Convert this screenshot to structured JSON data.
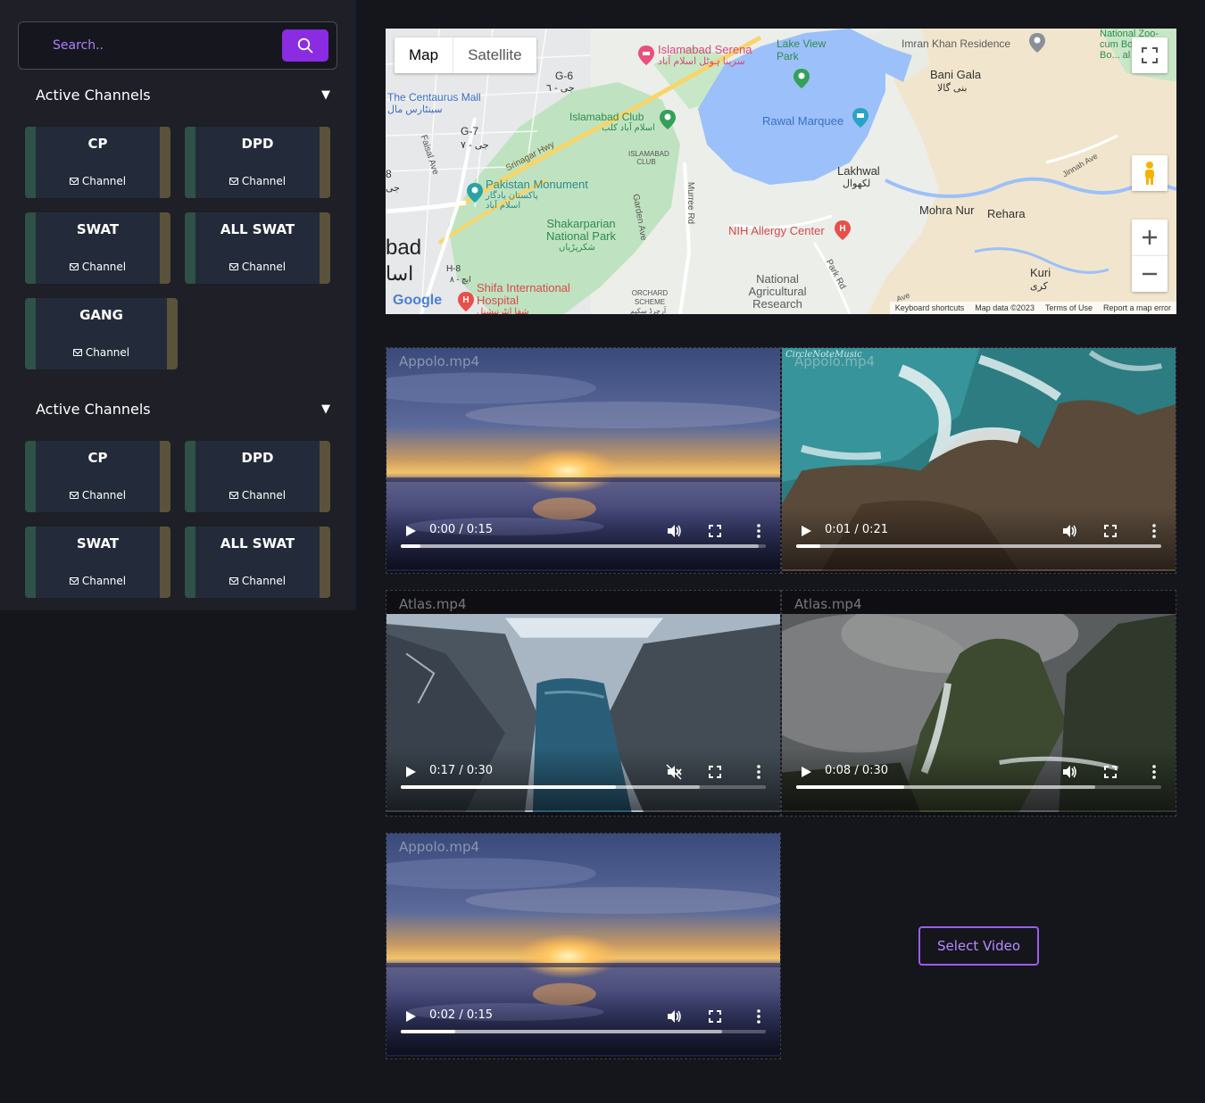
{
  "search": {
    "placeholder": "Search..",
    "button_icon": "search-icon"
  },
  "accent_color": "#8b2be2",
  "sections": [
    {
      "title": "Active Channels",
      "channels": [
        {
          "name": "CP",
          "sub": "Channel"
        },
        {
          "name": "DPD",
          "sub": "Channel"
        },
        {
          "name": "SWAT",
          "sub": "Channel"
        },
        {
          "name": "ALL SWAT",
          "sub": "Channel"
        },
        {
          "name": "GANG",
          "sub": "Channel"
        }
      ]
    },
    {
      "title": "Active Channels",
      "channels": [
        {
          "name": "CP",
          "sub": "Channel"
        },
        {
          "name": "DPD",
          "sub": "Channel"
        },
        {
          "name": "SWAT",
          "sub": "Channel"
        },
        {
          "name": "ALL SWAT",
          "sub": "Channel"
        }
      ]
    }
  ],
  "map": {
    "tabs": [
      "Map",
      "Satellite"
    ],
    "active_tab": "Map",
    "labels": {
      "serena": "Islamabad Serena",
      "serena_ur": "سرینا ہوٹل اسلام آباد",
      "lake_view": "Lake View Park",
      "imran": "Imran Khan Residence",
      "zoo": "National Zoo-cum Bo... & Bo... al Garden",
      "g6": "G-6",
      "g6_ur": "جی - ٦",
      "centaurus": "The Centaurus Mall",
      "centaurus_ur": "سینٹارس مال",
      "bani_gala": "Bani Gala",
      "bani_gala_ur": "بنی گالا",
      "club": "Islamabad Club",
      "club_ur": "اسلام آباد کلب",
      "rawal": "Rawal Marquee",
      "g7": "G-7",
      "g7_ur": "جی - ٧",
      "srinagar": "Srinagar Hwy",
      "isb_club_area": "ISLAMABAD CLUB",
      "lakhwal": "Lakhwal",
      "lakhwal_ur": "لکھوال",
      "faisal": "Faisal Ave",
      "monument": "Pakistan Monument",
      "monument_ur": "پاکستان یادگار اسلام آباد",
      "murree": "Murree Rd",
      "garden": "Garden Ave",
      "jinnah": "Jinnah Ave",
      "shakarparian": "Shakarparian National Park",
      "shakarparian_ur": "شکرپڑیاں",
      "mohra": "Mohra Nur",
      "rehara": "Rehara",
      "nih": "NIH Allergy Center",
      "bad": "bad",
      "bad_ur": "اسا",
      "h8": "H-8",
      "h8_ur": "ایچ - ٨",
      "shifa": "Shifa International Hospital",
      "shifa_ur": "شفا انٹرنیشنل",
      "narc": "National Agricultural Research",
      "orchard": "ORCHARD SCHEME",
      "orchard_ur": "آرچرڈ سکیم",
      "park_rd": "Park Rd",
      "kuri": "Kuri",
      "kuri_ur": "کری",
      "ave": "Ave",
      "g8": "8",
      "g8_ur": "جی",
      "google": "Google"
    },
    "footer": [
      "Keyboard shortcuts",
      "Map data ©2023",
      "Terms of Use",
      "Report a map error"
    ]
  },
  "videos": [
    {
      "title": "Appolo.mp4",
      "time": "0:00 / 0:15",
      "progress": 0.055,
      "buffered": 0.98,
      "muted": false,
      "scene": "sunset"
    },
    {
      "title": "Appolo.mp4",
      "time": "0:01 / 0:21",
      "progress": 0.065,
      "buffered": 1.0,
      "muted": false,
      "scene": "coast",
      "watermark": "CircleNoteMusic"
    },
    {
      "title": "Atlas.mp4",
      "time": "0:17 / 0:30",
      "progress": 0.59,
      "buffered": 0.82,
      "muted": true,
      "scene": "fjord"
    },
    {
      "title": "Atlas.mp4",
      "time": "0:08 / 0:30",
      "progress": 0.295,
      "buffered": 0.82,
      "muted": false,
      "scene": "waterfall"
    },
    {
      "title": "Appolo.mp4",
      "time": "0:02 / 0:15",
      "progress": 0.148,
      "buffered": 0.88,
      "muted": false,
      "scene": "sunset"
    }
  ],
  "select_video_label": "Select Video"
}
